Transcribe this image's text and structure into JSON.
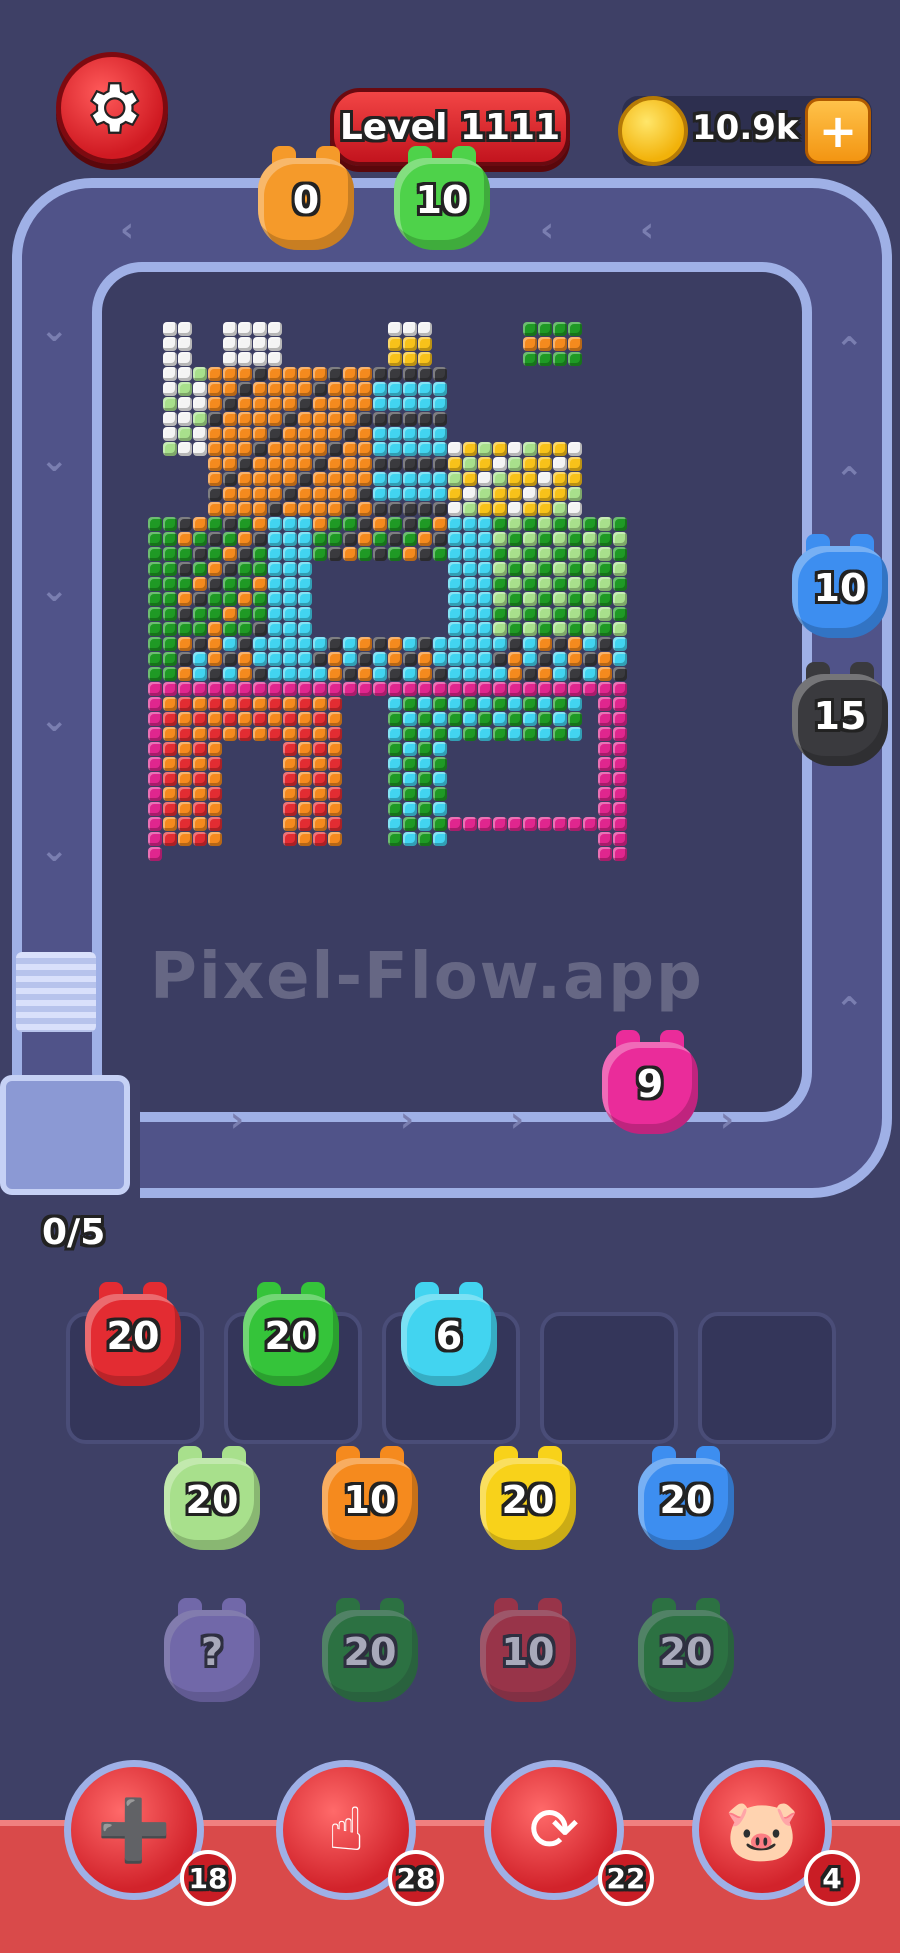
{
  "header": {
    "level_label": "Level 1111",
    "coins": "10.9k",
    "add_coins_label": "+"
  },
  "track": {
    "top_pigs": [
      {
        "count": "0",
        "color": "#f59a2a"
      },
      {
        "count": "10",
        "color": "#4ed24a"
      }
    ],
    "right_pigs": [
      {
        "count": "10",
        "color": "#3d8ef0"
      },
      {
        "count": "15",
        "color": "#3a3a3e"
      }
    ],
    "bottom_pig": {
      "count": "9",
      "color": "#ea2c9a"
    }
  },
  "watermark": "Pixel-Flow.app",
  "queue": {
    "progress": "0/5",
    "slots": [
      {
        "count": "20",
        "color": "#e32c32"
      },
      {
        "count": "20",
        "color": "#35c43a"
      },
      {
        "count": "6",
        "color": "#42d4f0"
      },
      {
        "count": "",
        "color": ""
      },
      {
        "count": "",
        "color": ""
      }
    ]
  },
  "grid": {
    "rows": [
      [
        {
          "count": "20",
          "color": "#a8e08c"
        },
        {
          "count": "10",
          "color": "#f58a1e"
        },
        {
          "count": "20",
          "color": "#f8d21a"
        },
        {
          "count": "20",
          "color": "#3d8ef0"
        }
      ],
      [
        {
          "count": "?",
          "color": "#9c8ae0"
        },
        {
          "count": "20",
          "color": "#1f9a25"
        },
        {
          "count": "10",
          "color": "#e32c32"
        },
        {
          "count": "20",
          "color": "#1f9a25"
        }
      ]
    ]
  },
  "tools": [
    {
      "name": "add-slot",
      "icon": "➕",
      "count": "18"
    },
    {
      "name": "hand",
      "icon": "☝",
      "count": "28"
    },
    {
      "name": "shuffle",
      "icon": "⟳",
      "count": "22"
    },
    {
      "name": "pig-train",
      "icon": "🐷",
      "count": "4"
    }
  ],
  "colors": {
    "white": "#f4f4f4",
    "orange": "#f58a1e",
    "yellow": "#f8c21a",
    "dark": "#3a3a3e",
    "cyan": "#42d4f0",
    "lightgreen": "#a8e08c",
    "green": "#1f9a25",
    "magenta": "#e0268e",
    "red": "#e32c32"
  }
}
